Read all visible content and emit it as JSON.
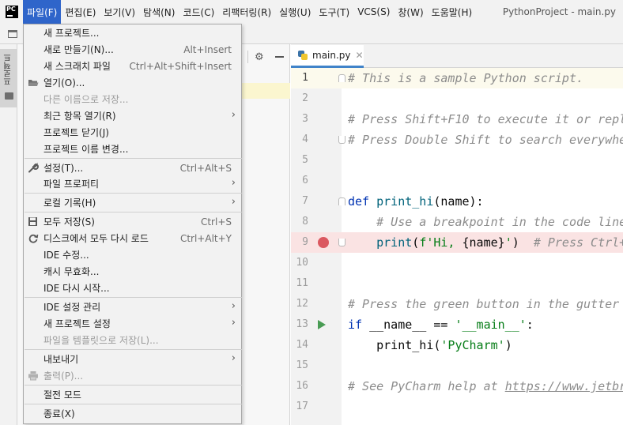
{
  "window": {
    "app_logo": "PC",
    "title": "PythonProject - main.py"
  },
  "menubar": {
    "items": [
      {
        "label": "파일(F)"
      },
      {
        "label": "편집(E)"
      },
      {
        "label": "보기(V)"
      },
      {
        "label": "탐색(N)"
      },
      {
        "label": "코드(C)"
      },
      {
        "label": "리팩터링(R)"
      },
      {
        "label": "실행(U)"
      },
      {
        "label": "도구(T)"
      },
      {
        "label": "VCS(S)"
      },
      {
        "label": "창(W)"
      },
      {
        "label": "도움말(H)"
      }
    ]
  },
  "tool_stripe": {
    "project_label": "프로젝트"
  },
  "file_menu": {
    "items": [
      {
        "label": "새 프로젝트...",
        "shortcut": "",
        "disabled": false,
        "submenu": false
      },
      {
        "label": "새로 만들기(N)...",
        "shortcut": "Alt+Insert",
        "disabled": false,
        "submenu": false
      },
      {
        "label": "새 스크래치 파일",
        "shortcut": "Ctrl+Alt+Shift+Insert",
        "disabled": false,
        "submenu": false
      },
      {
        "label": "열기(O)...",
        "shortcut": "",
        "disabled": false,
        "submenu": false,
        "icon": "folder-open-icon"
      },
      {
        "label": "다른 이름으로 저장...",
        "shortcut": "",
        "disabled": true,
        "submenu": false
      },
      {
        "label": "최근 항목 열기(R)",
        "shortcut": "",
        "disabled": false,
        "submenu": true
      },
      {
        "label": "프로젝트 닫기(J)",
        "shortcut": "",
        "disabled": false,
        "submenu": false
      },
      {
        "label": "프로젝트 이름 변경...",
        "shortcut": "",
        "disabled": false,
        "submenu": false
      },
      {
        "label": "설정(T)...",
        "shortcut": "Ctrl+Alt+S",
        "disabled": false,
        "submenu": false,
        "icon": "wrench-icon"
      },
      {
        "label": "파일 프로퍼티",
        "shortcut": "",
        "disabled": false,
        "submenu": true
      },
      {
        "label": "로컬 기록(H)",
        "shortcut": "",
        "disabled": false,
        "submenu": true
      },
      {
        "label": "모두 저장(S)",
        "shortcut": "Ctrl+S",
        "disabled": false,
        "submenu": false,
        "icon": "save-icon"
      },
      {
        "label": "디스크에서 모두 다시 로드",
        "shortcut": "Ctrl+Alt+Y",
        "disabled": false,
        "submenu": false,
        "icon": "reload-icon"
      },
      {
        "label": "IDE 수정...",
        "shortcut": "",
        "disabled": false,
        "submenu": false
      },
      {
        "label": "캐시 무효화...",
        "shortcut": "",
        "disabled": false,
        "submenu": false
      },
      {
        "label": "IDE 다시 시작...",
        "shortcut": "",
        "disabled": false,
        "submenu": false
      },
      {
        "label": "IDE 설정 관리",
        "shortcut": "",
        "disabled": false,
        "submenu": true
      },
      {
        "label": "새 프로젝트 설정",
        "shortcut": "",
        "disabled": false,
        "submenu": true
      },
      {
        "label": "파일을 템플릿으로 저장(L)...",
        "shortcut": "",
        "disabled": true,
        "submenu": false
      },
      {
        "label": "내보내기",
        "shortcut": "",
        "disabled": false,
        "submenu": true
      },
      {
        "label": "출력(P)...",
        "shortcut": "",
        "disabled": true,
        "submenu": false,
        "icon": "print-icon"
      },
      {
        "label": "절전 모드",
        "shortcut": "",
        "disabled": false,
        "submenu": false
      },
      {
        "label": "종료(X)",
        "shortcut": "",
        "disabled": false,
        "submenu": false
      }
    ]
  },
  "editor": {
    "tab_label": "main.py",
    "lines": [
      {
        "n": "1",
        "text": "# This is a sample Python script."
      },
      {
        "n": "2",
        "text": ""
      },
      {
        "n": "3",
        "text": "# Press Shift+F10 to execute it or repl"
      },
      {
        "n": "4",
        "text": "# Press Double Shift to search everywhe"
      },
      {
        "n": "5",
        "text": ""
      },
      {
        "n": "6",
        "text": ""
      },
      {
        "n": "7",
        "text": "def print_hi(name):"
      },
      {
        "n": "8",
        "text": "    # Use a breakpoint in the code line"
      },
      {
        "n": "9",
        "text": "    print(f'Hi, {name}')  # Press Ctrl+"
      },
      {
        "n": "10",
        "text": ""
      },
      {
        "n": "11",
        "text": ""
      },
      {
        "n": "12",
        "text": "# Press the green button in the gutter"
      },
      {
        "n": "13",
        "text": "if __name__ == '__main__':"
      },
      {
        "n": "14",
        "text": "    print_hi('PyCharm')"
      },
      {
        "n": "15",
        "text": ""
      },
      {
        "n": "16",
        "text": "# See PyCharm help at https://www.jetbr"
      },
      {
        "n": "17",
        "text": ""
      }
    ]
  },
  "colors": {
    "menu_active": "#2f65ca",
    "breakpoint": "#db5860",
    "run_marker": "#499c54",
    "comment": "#8c8c8c",
    "keyword": "#0033b3",
    "string": "#067d17"
  }
}
